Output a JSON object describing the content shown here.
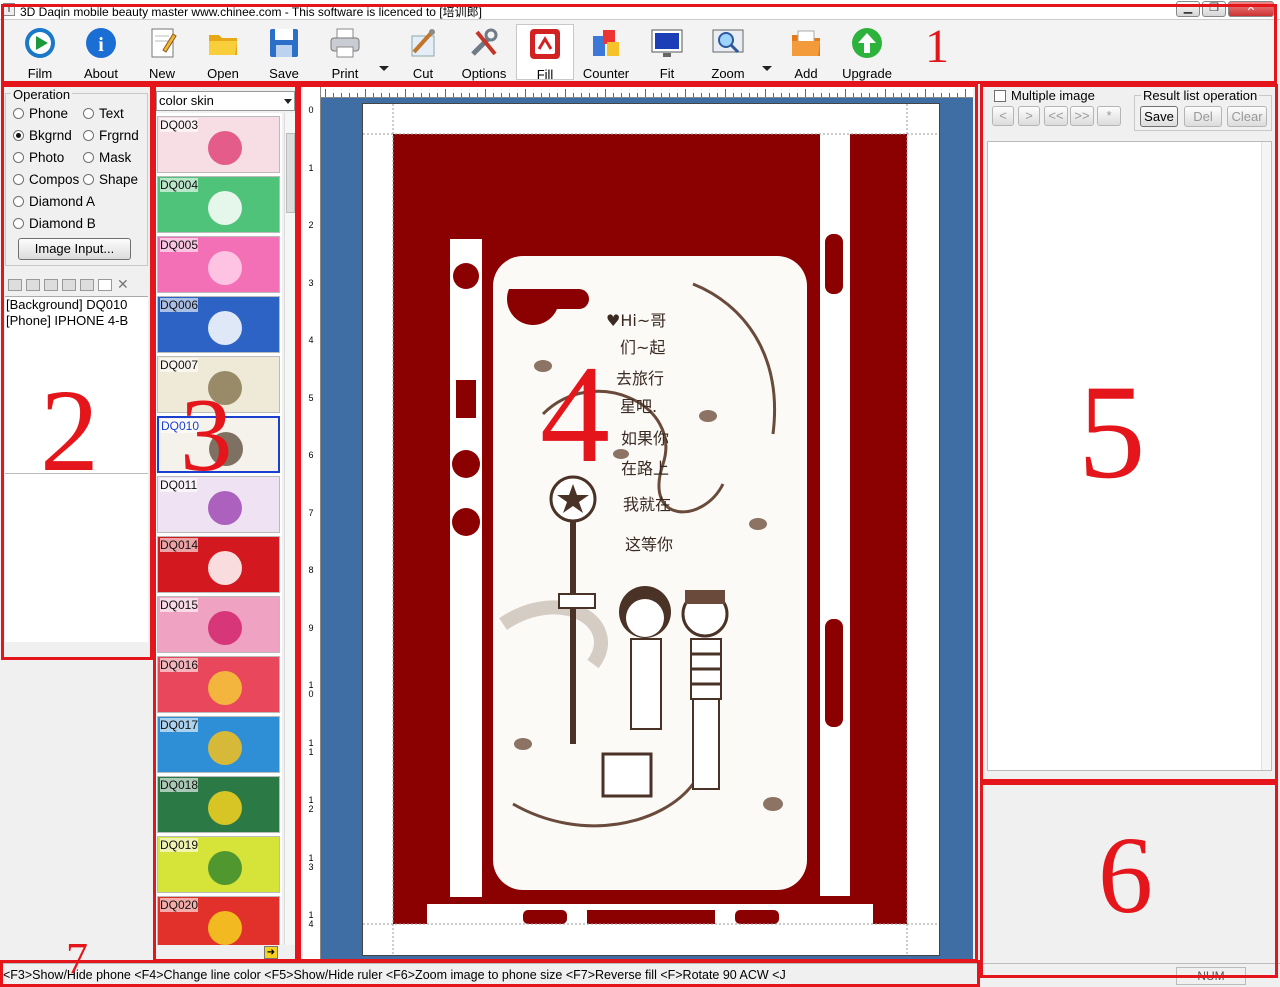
{
  "window": {
    "title": "3D Daqin mobile beauty master www.chinee.com - This software is licenced to [培训郎]",
    "minimize_label": "▁",
    "maximize_label": "❐",
    "close_label": "✕"
  },
  "toolbar": {
    "items": [
      {
        "label": "Film",
        "icon": "film-icon"
      },
      {
        "label": "About",
        "icon": "info-icon"
      },
      {
        "label": "New",
        "icon": "new-document-icon"
      },
      {
        "label": "Open",
        "icon": "folder-open-icon"
      },
      {
        "label": "Save",
        "icon": "floppy-disk-icon"
      },
      {
        "label": "Print",
        "icon": "printer-icon"
      },
      {
        "label": "Cut",
        "icon": "cutter-icon"
      },
      {
        "label": "Options",
        "icon": "tools-icon"
      },
      {
        "label": "Fill",
        "icon": "fill-icon",
        "active": true
      },
      {
        "label": "Counter",
        "icon": "counter-icon"
      },
      {
        "label": "Fit",
        "icon": "fit-monitor-icon"
      },
      {
        "label": "Zoom",
        "icon": "zoom-icon"
      },
      {
        "label": "Add",
        "icon": "add-folder-icon"
      },
      {
        "label": "Upgrade",
        "icon": "upgrade-arrow-icon"
      }
    ]
  },
  "annotations": {
    "n1": "1",
    "n2": "2",
    "n3": "3",
    "n4": "4",
    "n5": "5",
    "n6": "6",
    "n7": "7",
    "color": "#e4161b"
  },
  "operation": {
    "legend": "Operation",
    "options": [
      {
        "label": "Phone",
        "checked": false
      },
      {
        "label": "Text",
        "checked": false
      },
      {
        "label": "Bkgrnd",
        "checked": true
      },
      {
        "label": "Frgrnd",
        "checked": false
      },
      {
        "label": "Photo",
        "checked": false
      },
      {
        "label": "Mask",
        "checked": false
      },
      {
        "label": "Compos",
        "checked": false
      },
      {
        "label": "Shape",
        "checked": false
      },
      {
        "label": "Diamond A",
        "checked": false
      },
      {
        "label": "Diamond B",
        "checked": false
      }
    ],
    "image_input_label": "Image Input..."
  },
  "layers": [
    "[Background] DQ010",
    "[Phone] IPHONE 4-B"
  ],
  "skins": {
    "selected_category": "color skin",
    "items": [
      {
        "code": "DQ003",
        "color": "#f7dde4",
        "accent": "#e0457a"
      },
      {
        "code": "DQ004",
        "color": "#4fc37a",
        "accent": "#ffffff"
      },
      {
        "code": "DQ005",
        "color": "#f36fb6",
        "accent": "#ffd2ea"
      },
      {
        "code": "DQ006",
        "color": "#2d63c4",
        "accent": "#ffffff"
      },
      {
        "code": "DQ007",
        "color": "#efe9d8",
        "accent": "#8a7a55"
      },
      {
        "code": "DQ010",
        "color": "#f5f2ec",
        "accent": "#6a5a4a",
        "selected": true
      },
      {
        "code": "DQ011",
        "color": "#efe2f3",
        "accent": "#a04ab5"
      },
      {
        "code": "DQ014",
        "color": "#d3181f",
        "accent": "#ffffff"
      },
      {
        "code": "DQ015",
        "color": "#f0a2c2",
        "accent": "#d2236c"
      },
      {
        "code": "DQ016",
        "color": "#e9475b",
        "accent": "#f5c93a"
      },
      {
        "code": "DQ017",
        "color": "#2e8fd6",
        "accent": "#f4c11d"
      },
      {
        "code": "DQ018",
        "color": "#2b7a46",
        "accent": "#f5d21f"
      },
      {
        "code": "DQ019",
        "color": "#d6e43a",
        "accent": "#3a8a2f"
      },
      {
        "code": "DQ020",
        "color": "#e2312a",
        "accent": "#f5d21f"
      }
    ]
  },
  "ruler": {
    "left_marks": [
      "0",
      "1",
      "2",
      "3",
      "4",
      "5",
      "6",
      "7",
      "8",
      "9",
      "1\n0",
      "1\n1",
      "1\n2",
      "1\n3",
      "1\n4"
    ]
  },
  "design": {
    "phone_model": "IPHONE 4-B",
    "skin_color": "#8b0000",
    "canvas_bg": "#3e6ea4",
    "art_text": [
      "♥Hi~哥",
      "们~起",
      "去旅行",
      "星吧.",
      "如果你",
      "在路上",
      "我就在",
      "这等你"
    ]
  },
  "results": {
    "multiple_image_label": "Multiple image",
    "multiple_image_checked": false,
    "nav": [
      "<",
      ">",
      "<<",
      ">>",
      "*"
    ],
    "group_legend": "Result list operation",
    "save_label": "Save",
    "del_label": "Del",
    "clear_label": "Clear"
  },
  "status": {
    "hints": "<F3>Show/Hide phone <F4>Change line color <F5>Show/Hide ruler <F6>Zoom image to phone size <F7>Reverse fill <F>Rotate 90 ACW <J",
    "num_indicator": "NUM"
  }
}
